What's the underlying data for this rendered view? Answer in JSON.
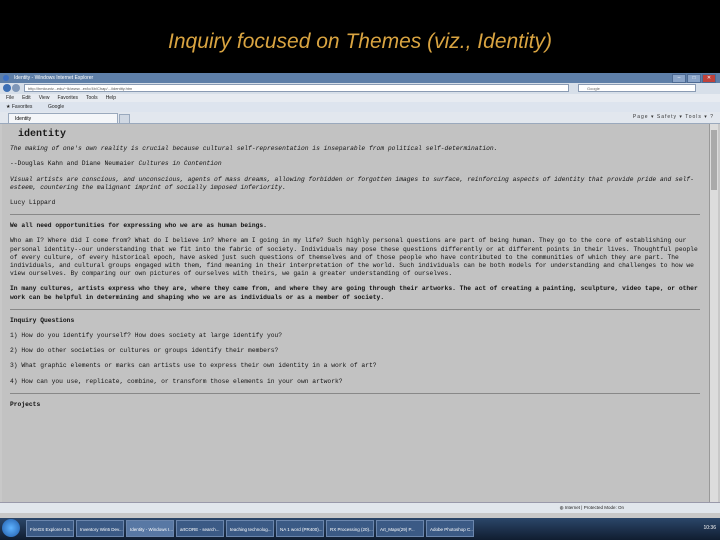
{
  "slide": {
    "title": "Inquiry focused on Themes (viz., Identity)"
  },
  "browser": {
    "window_title": "Identity - Windows Internet Explorer",
    "url": "http://hmlcuniv...edu/~lk/www...er/ic/4b/Chap/.../identity.htm",
    "search_placeholder": "Google",
    "menu": [
      "File",
      "Edit",
      "View",
      "Favorites",
      "Tools",
      "Help"
    ],
    "favorites_label": "Favorites",
    "favorite_item": "Google",
    "tab_label": "Identity",
    "tools_label": "Page ▾  Safety ▾  Tools ▾  ?"
  },
  "page": {
    "heading": "identity",
    "quote": "The making of one's own reality is crucial because cultural self-representation is inseparable from political self-determination.",
    "quote_attr_prefix": "--Douglas Kahn and Diane Neumaier",
    "quote_attr_book": "Cultures in Contention",
    "lippard_quote": "Visual artists are conscious, and unconscious, agents of mass dreams, allowing forbidden or forgotten images to surface, reinforcing aspects of identity that provide pride and self-esteem, countering the malignant imprint of socially imposed inferiority.",
    "lippard_attr": "Lucy Lippard",
    "section_heading": "We all need opportunities for expressing who we are as human beings.",
    "para1": "Who am I? Where did I come from? What do I believe in? Where am I going in my life? Such highly personal questions are part of being human. They go to the core of establishing our personal identity--our understanding that we fit into the fabric of society. Individuals may pose these questions differently or at different points in their lives. Thoughtful people of every culture, of every historical epoch, have asked just such questions of themselves and of those people who have contributed to the communities of which they are part. The individuals, and cultural groups engaged with them, find meaning in their interpretation of the world. Such individuals can be both models for understanding and challenges to how we view ourselves. By comparing our own pictures of ourselves with theirs, we gain a greater understanding of ourselves.",
    "para2": "In many cultures, artists express who they are, where they came from, and where they are going through their artworks. The act of creating a painting, sculpture, video tape, or other work can be helpful in determining and shaping who we are as individuals or as a member of society.",
    "inquiry_heading": "Inquiry Questions",
    "questions": [
      "1) How do you identify yourself? How does society at large identify you?",
      "2) How do other societies or cultures or groups identify their members?",
      "3) What graphic elements or marks can artists use to express their own identity in a work of art?",
      "4) How can you use, replicate, combine, or transform those elements in your own artwork?"
    ],
    "projects_heading": "Projects"
  },
  "status": {
    "zone": "Internet | Protected Mode: On"
  },
  "taskbar": {
    "items": [
      "FireGS Explorer 6.5...",
      "Inventory Win5 Dev...",
      "Identity - Windows I...",
      "artCORE - search...",
      "teaching technolog...",
      "NA 1 word (PR400)...",
      "RX Processing (20)...",
      "Art_Maps(29) P...",
      "Adobe Photoshop C..."
    ],
    "active_index": 2,
    "clock": "10:36"
  }
}
